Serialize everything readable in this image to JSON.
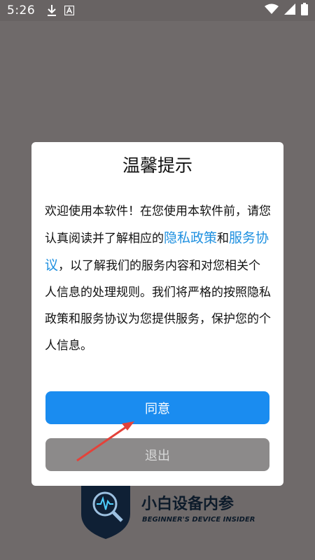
{
  "statusbar": {
    "time": "5:26",
    "icons_left": [
      "download-icon",
      "a-notification-icon"
    ],
    "icons_right": [
      "wifi-icon",
      "cellular-signal-icon",
      "battery-icon"
    ]
  },
  "background_app": {
    "name": "小白设备内参",
    "subtitle": "BEGINNER'S DEVICE INSIDER",
    "logo": "shield-magnifier-logo"
  },
  "dialog": {
    "title": "温馨提示",
    "body_text_1": "欢迎使用本软件！在您使用本软件前，请您认真阅读并了解相应的",
    "privacy_link": "隐私政策",
    "body_and": "和",
    "service_link": "服务协议",
    "body_text_2": "，以了解我们的服务内容和对您相关个人信息的处理规则。我们将严格的按照隐私政策和服务协议为您提供服务，保护您的个人信息。",
    "agree_label": "同意",
    "exit_label": "退出"
  },
  "annotation": {
    "arrow_color": "#e4423a"
  },
  "colors": {
    "overlay": "#6f6a6a",
    "primary": "#1a8cf0",
    "link": "#1e90e0",
    "exit_button": "#8c8a8a"
  }
}
